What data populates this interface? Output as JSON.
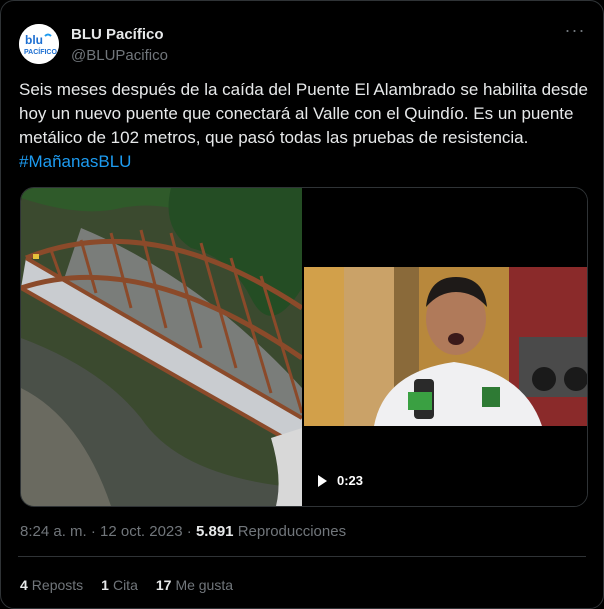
{
  "author": {
    "name": "BLU Pacífico",
    "handle": "@BLUPacifico",
    "avatar_text": "blu PACÍFICO"
  },
  "tweet": {
    "text_main": "Seis meses después de la caída del Puente El Alambrado se habilita desde hoy un nuevo puente que conectará al Valle con el Quindío. Es un puente metálico de 102 metros, que pasó todas las pruebas de resistencia. ",
    "hashtag": "#MañanasBLU"
  },
  "media": {
    "video_duration": "0:23"
  },
  "meta": {
    "time": "8:24 a. m.",
    "separator": "·",
    "date": "12 oct. 2023",
    "views_count": "5.891",
    "views_label": "Reproducciones"
  },
  "stats": {
    "reposts_count": "4",
    "reposts_label": "Reposts",
    "quotes_count": "1",
    "quotes_label": "Cita",
    "likes_count": "17",
    "likes_label": "Me gusta"
  },
  "colors": {
    "accent": "#1d9bf0",
    "muted": "#71767b",
    "border": "#2f3336"
  }
}
